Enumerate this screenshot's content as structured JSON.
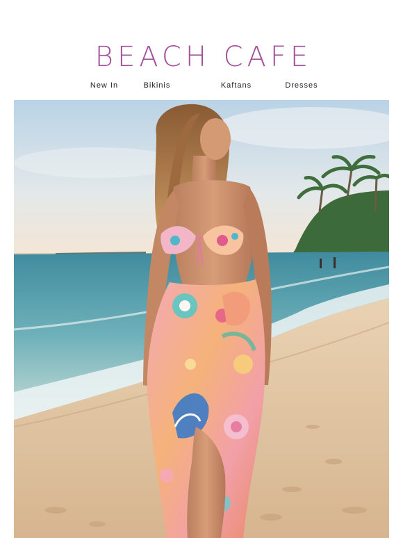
{
  "brand": {
    "name": "BEACH CAFE",
    "color": "#a4509a"
  },
  "nav": {
    "items": [
      {
        "label": "New In"
      },
      {
        "label": "Bikinis"
      },
      {
        "label": "Kaftans"
      },
      {
        "label": "Dresses"
      }
    ]
  },
  "hero": {
    "image_subject": "model-in-bikini-and-printed-sarong-on-beach"
  }
}
